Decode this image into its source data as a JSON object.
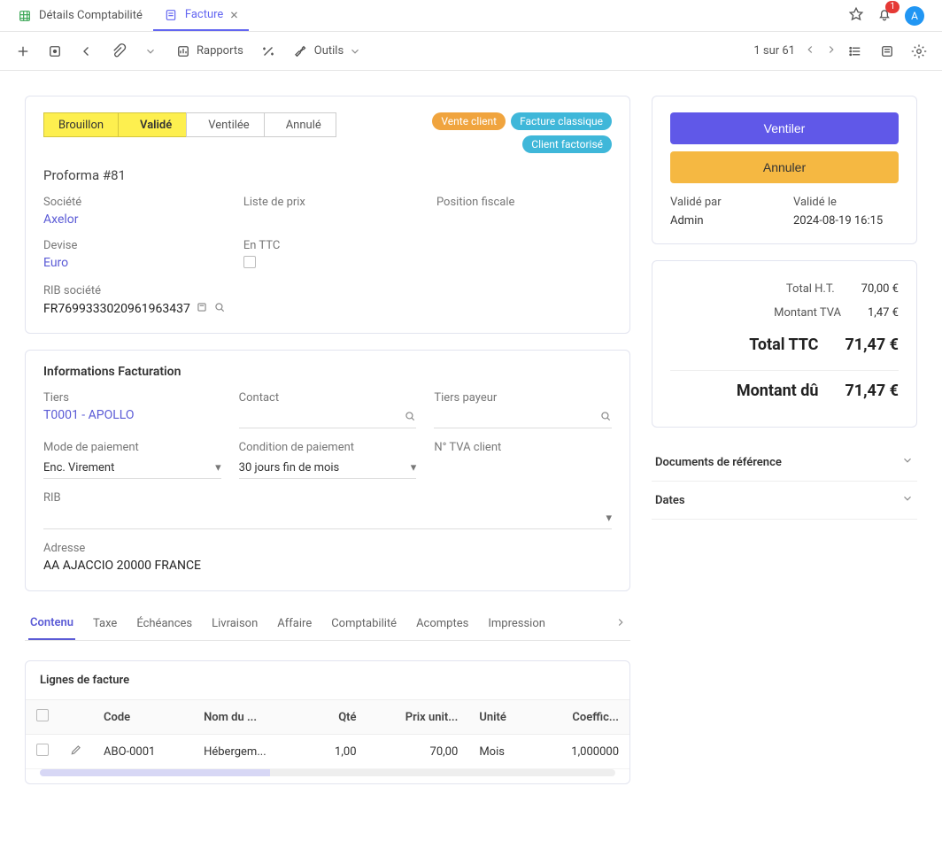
{
  "tabs": {
    "t0": "Détails Comptabilité",
    "t1": "Facture"
  },
  "topbar": {
    "notif_count": "1",
    "avatar_letter": "A"
  },
  "toolbar": {
    "reports": "Rapports",
    "tools": "Outils",
    "pager": "1 sur 61"
  },
  "status": {
    "s0": "Brouillon",
    "s1": "Validé",
    "s2": "Ventilée",
    "s3": "Annulé"
  },
  "badges": {
    "b0": {
      "label": "Vente client",
      "color": "#f0a43e"
    },
    "b1": {
      "label": "Facture classique",
      "color": "#3fb7d9"
    },
    "b2": {
      "label": "Client factorisé",
      "color": "#3fb7d9"
    }
  },
  "header": {
    "proforma": "Proforma #81",
    "labels": {
      "company": "Société",
      "currency": "Devise",
      "rib_company": "RIB société",
      "pricelist": "Liste de prix",
      "in_ttc": "En TTC",
      "fiscal": "Position fiscale"
    },
    "company": "Axelor",
    "currency": "Euro",
    "rib_company": "FR7699333020961963437"
  },
  "billing": {
    "title": "Informations Facturation",
    "labels": {
      "tiers": "Tiers",
      "contact": "Contact",
      "payer": "Tiers payeur",
      "pay_mode": "Mode de paiement",
      "pay_cond": "Condition de paiement",
      "vat": "N° TVA client",
      "rib": "RIB",
      "address": "Adresse"
    },
    "tiers": "T0001 - APOLLO",
    "pay_mode": "Enc. Virement",
    "pay_cond": "30 jours fin de mois",
    "address": "AA AJACCIO 20000 FRANCE"
  },
  "innertabs": {
    "t0": "Contenu",
    "t1": "Taxe",
    "t2": "Échéances",
    "t3": "Livraison",
    "t4": "Affaire",
    "t5": "Comptabilité",
    "t6": "Acomptes",
    "t7": "Impression"
  },
  "lines": {
    "title": "Lignes de facture",
    "cols": {
      "code": "Code",
      "name": "Nom du ...",
      "qty": "Qté",
      "unitprice": "Prix unit...",
      "unit": "Unité",
      "coef": "Coeffic..."
    },
    "row0": {
      "code": "ABO-0001",
      "name": "Hébergem...",
      "qty": "1,00",
      "unitprice": "70,00",
      "unit": "Mois",
      "coef": "1,000000"
    }
  },
  "side": {
    "btn_ventiler": "Ventiler",
    "btn_annuler": "Annuler",
    "validated_by_label": "Validé par",
    "validated_on_label": "Validé le",
    "validated_by": "Admin",
    "validated_on": "2024-08-19 16:15"
  },
  "totals": {
    "ht_label": "Total H.T.",
    "ht": "70,00 €",
    "tva_label": "Montant TVA",
    "tva": "1,47 €",
    "ttc_label": "Total TTC",
    "ttc": "71,47 €",
    "due_label": "Montant dû",
    "due": "71,47 €"
  },
  "accordion": {
    "docs": "Documents de référence",
    "dates": "Dates"
  }
}
